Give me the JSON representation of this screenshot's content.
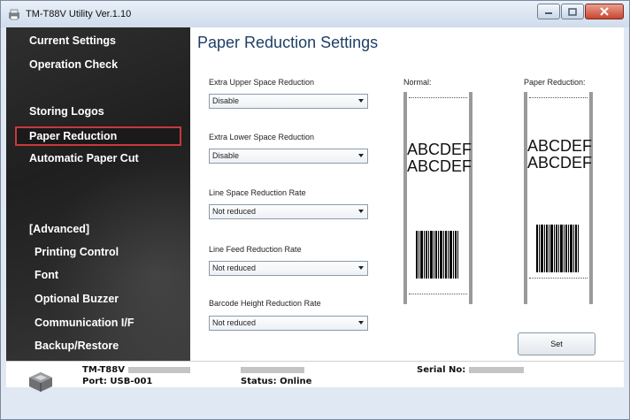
{
  "window": {
    "title": "TM-T88V Utility Ver.1.10"
  },
  "sidebar": {
    "items": [
      {
        "label": "Current Settings"
      },
      {
        "label": "Operation Check"
      },
      {
        "label": "Storing Logos"
      },
      {
        "label": "Paper Reduction",
        "selected": true
      },
      {
        "label": "Automatic Paper Cut"
      },
      {
        "label": "[Advanced]"
      },
      {
        "label": "Printing Control"
      },
      {
        "label": "Font"
      },
      {
        "label": "Optional Buzzer"
      },
      {
        "label": "Communication I/F"
      },
      {
        "label": "Backup/Restore"
      }
    ]
  },
  "main": {
    "title": "Paper Reduction Settings",
    "fields": [
      {
        "label": "Extra Upper Space Reduction",
        "value": "Disable"
      },
      {
        "label": "Extra Lower Space Reduction",
        "value": "Disable"
      },
      {
        "label": "Line Space Reduction Rate",
        "value": "Not reduced"
      },
      {
        "label": "Line Feed Reduction Rate",
        "value": "Not reduced"
      },
      {
        "label": "Barcode Height Reduction Rate",
        "value": "Not reduced"
      }
    ],
    "preview": {
      "normal_label": "Normal:",
      "reduced_label": "Paper Reduction:",
      "sample_line1": "ABCDEF",
      "sample_line2": "ABCDEF"
    },
    "set_button": "Set"
  },
  "footer": {
    "model": "TM-T88V",
    "port": "Port: USB-001",
    "status": "Status: Online",
    "serial_label": "Serial No:"
  },
  "colors": {
    "sidebar_bg": "#262626",
    "selected_border": "#c8393b",
    "title_color": "#1e3f66"
  }
}
